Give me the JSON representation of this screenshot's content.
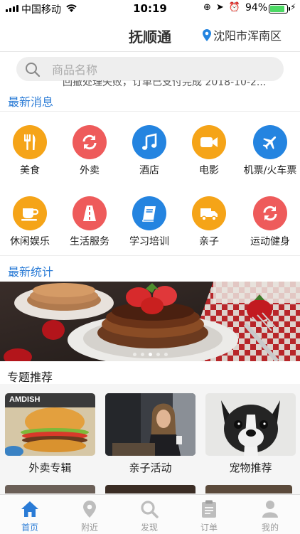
{
  "status_bar": {
    "carrier": "中国移动",
    "time": "10:19",
    "battery": "94%",
    "battery_level": 0.94
  },
  "nav": {
    "title": "抚顺通",
    "location": "沈阳市浑南区",
    "location_icon": "location-pin-icon"
  },
  "search": {
    "placeholder": "商品名称",
    "icon": "search-icon"
  },
  "news": {
    "ticker": "回撤处理失败，订单已支付完成 2018-10-2...",
    "section_title": "最新消息"
  },
  "categories": [
    {
      "label": "美食",
      "icon": "fork-knife-icon",
      "color": "#f5a418"
    },
    {
      "label": "外卖",
      "icon": "refresh-icon",
      "color": "#ee5b5b"
    },
    {
      "label": "酒店",
      "icon": "music-note-icon",
      "color": "#2484e0"
    },
    {
      "label": "电影",
      "icon": "video-camera-icon",
      "color": "#f5a418"
    },
    {
      "label": "机票/火车票",
      "icon": "airplane-icon",
      "color": "#2484e0"
    },
    {
      "label": "休闲娱乐",
      "icon": "coffee-cup-icon",
      "color": "#f5a418"
    },
    {
      "label": "生活服务",
      "icon": "road-icon",
      "color": "#ee5b5b"
    },
    {
      "label": "学习培训",
      "icon": "book-icon",
      "color": "#2484e0"
    },
    {
      "label": "亲子",
      "icon": "truck-icon",
      "color": "#f5a418"
    },
    {
      "label": "运动健身",
      "icon": "refresh-icon",
      "color": "#ee5b5b"
    }
  ],
  "stats": {
    "section_title": "最新统计"
  },
  "banner": {
    "image": "pancake-dessert-photo",
    "slides": 5,
    "active_slide": 2
  },
  "topics": {
    "section_title": "专题推荐",
    "items": [
      {
        "label": "外卖专辑",
        "image": "burger-photo",
        "image_text": "AMDISH"
      },
      {
        "label": "亲子活动",
        "image": "woman-cafe-photo"
      },
      {
        "label": "宠物推荐",
        "image": "french-bulldog-photo"
      }
    ]
  },
  "tabbar": {
    "items": [
      {
        "label": "首页",
        "icon": "home-icon",
        "active": true
      },
      {
        "label": "附近",
        "icon": "location-pin-icon",
        "active": false
      },
      {
        "label": "发现",
        "icon": "search-icon",
        "active": false
      },
      {
        "label": "订单",
        "icon": "clipboard-icon",
        "active": false
      },
      {
        "label": "我的",
        "icon": "user-icon",
        "active": false
      }
    ]
  },
  "colors": {
    "accent": "#2a7bd6",
    "orange": "#f5a418",
    "red": "#ee5b5b",
    "blue": "#2484e0"
  }
}
